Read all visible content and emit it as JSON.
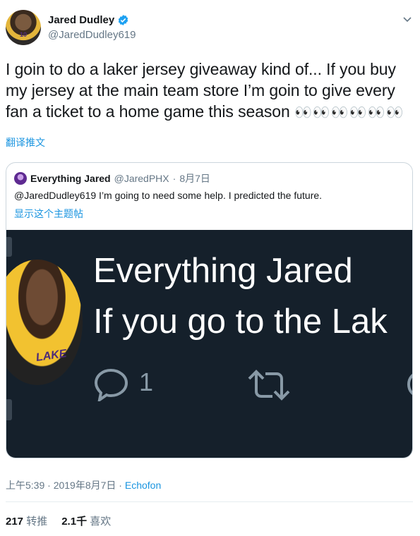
{
  "author": {
    "display_name": "Jared Dudley",
    "handle": "@JaredDudley619",
    "avatar_icon": "avatar-photo",
    "avatar_number": "10"
  },
  "tweet": {
    "text": "I goin to do a laker jersey giveaway kind of... If you buy my jersey at the main team store I’m goin to give every fan a ticket to a home game this season",
    "emoji": "👀👀👀👀👀👀",
    "translate_label": "翻译推文"
  },
  "quoted": {
    "display_name": "Everything Jared",
    "handle": "@JaredPHX",
    "separator": "·",
    "date": "8月7日",
    "text": "@JaredDudley619 I’m going to need some help. I predicted the future.",
    "thread_link": "显示这个主题帖",
    "image": {
      "name": "Everything Jared",
      "subtitle": "If you go to the Lak",
      "jersey_text": "LAKE",
      "reply_count": "1"
    }
  },
  "meta": {
    "timestamp": "上午5:39 · 2019年8月7日 · ",
    "source": "Echofon"
  },
  "stats": {
    "retweets": "217",
    "retweets_label": "转推",
    "likes": "2.1千",
    "likes_label": "喜欢"
  },
  "colors": {
    "link": "#1b95e0",
    "muted": "#657786",
    "image_bg": "#15202b",
    "verified": "#1da1f2"
  }
}
